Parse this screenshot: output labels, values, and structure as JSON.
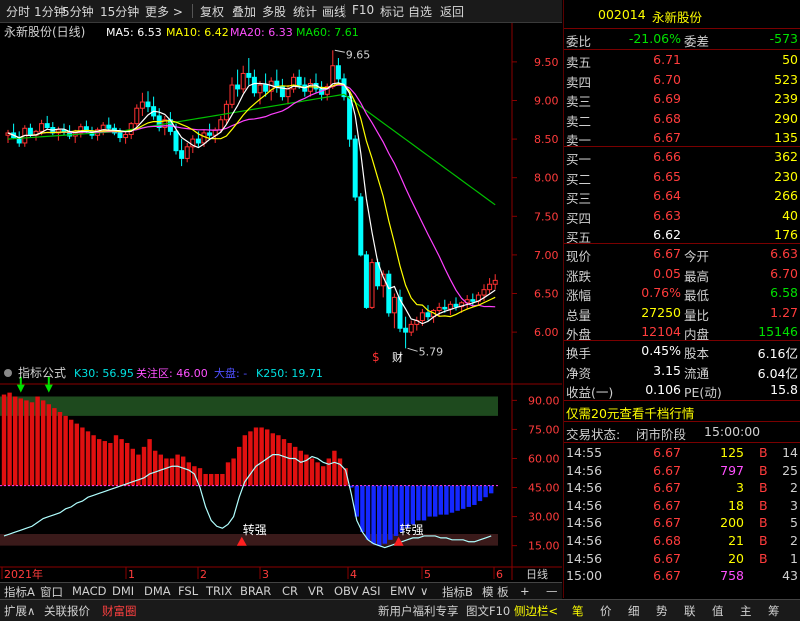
{
  "toolbar": {
    "items": [
      "分时",
      "1分钟",
      "5分钟",
      "15分钟",
      "更多 >",
      "复权",
      "叠加",
      "多股",
      "统计",
      "画线",
      "F10",
      "标记",
      "自选",
      "返回"
    ]
  },
  "stock": {
    "code": "002014",
    "name": "永新股份"
  },
  "main_legend": {
    "title": "永新股份(日线)",
    "ma5": "MA5: 6.53",
    "ma10": "MA10: 6.42",
    "ma20": "MA20: 6.33",
    "ma60": "MA60: 7.61"
  },
  "indicator_legend": {
    "title": "指标公式",
    "k30": "K30: 56.95",
    "focus": "关注区: 46.00",
    "dapan": "大盘: -",
    "k250": "K250: 19.71"
  },
  "annotations": {
    "high": "9.65",
    "low": "5.79",
    "s_mark": "$",
    "cai_mark": "财",
    "strong1": "转强",
    "strong2": "转强"
  },
  "xaxis": {
    "labels": [
      "2021年",
      "1",
      "2",
      "3",
      "4",
      "5",
      "6"
    ],
    "period": "日线"
  },
  "colors": {
    "up": "#ff3232",
    "down": "#00ffff",
    "ma5": "#ffffff",
    "ma10": "#ffff00",
    "ma20": "#ff40ff",
    "ma60": "#00c000",
    "bg": "#000000"
  },
  "chart_data": [
    {
      "type": "candlestick",
      "title": "永新股份(日线)",
      "ylim": [
        5.6,
        9.9
      ],
      "yticks": [
        6.0,
        6.5,
        7.0,
        7.5,
        8.0,
        8.5,
        9.0,
        9.5
      ],
      "ohlc": [
        [
          8.55,
          8.62,
          8.45,
          8.58
        ],
        [
          8.58,
          8.7,
          8.5,
          8.52
        ],
        [
          8.52,
          8.6,
          8.4,
          8.45
        ],
        [
          8.45,
          8.68,
          8.4,
          8.64
        ],
        [
          8.64,
          8.7,
          8.52,
          8.55
        ],
        [
          8.55,
          8.62,
          8.48,
          8.6
        ],
        [
          8.6,
          8.75,
          8.55,
          8.7
        ],
        [
          8.7,
          8.8,
          8.62,
          8.65
        ],
        [
          8.65,
          8.72,
          8.55,
          8.58
        ],
        [
          8.58,
          8.66,
          8.48,
          8.62
        ],
        [
          8.62,
          8.7,
          8.55,
          8.6
        ],
        [
          8.6,
          8.68,
          8.5,
          8.54
        ],
        [
          8.54,
          8.62,
          8.45,
          8.58
        ],
        [
          8.58,
          8.7,
          8.52,
          8.66
        ],
        [
          8.66,
          8.74,
          8.58,
          8.6
        ],
        [
          8.6,
          8.66,
          8.5,
          8.55
        ],
        [
          8.55,
          8.65,
          8.48,
          8.62
        ],
        [
          8.62,
          8.72,
          8.55,
          8.68
        ],
        [
          8.68,
          8.78,
          8.6,
          8.64
        ],
        [
          8.64,
          8.7,
          8.55,
          8.58
        ],
        [
          8.58,
          8.64,
          8.46,
          8.52
        ],
        [
          8.52,
          8.6,
          8.44,
          8.56
        ],
        [
          8.56,
          8.72,
          8.5,
          8.7
        ],
        [
          8.7,
          8.95,
          8.65,
          8.9
        ],
        [
          8.9,
          9.1,
          8.8,
          8.98
        ],
        [
          8.98,
          9.12,
          8.85,
          8.92
        ],
        [
          8.92,
          9.05,
          8.75,
          8.8
        ],
        [
          8.8,
          8.9,
          8.6,
          8.65
        ],
        [
          8.65,
          8.8,
          8.55,
          8.75
        ],
        [
          8.75,
          8.85,
          8.55,
          8.6
        ],
        [
          8.6,
          8.7,
          8.3,
          8.35
        ],
        [
          8.35,
          8.5,
          8.15,
          8.25
        ],
        [
          8.25,
          8.45,
          8.2,
          8.4
        ],
        [
          8.4,
          8.55,
          8.32,
          8.5
        ],
        [
          8.5,
          8.6,
          8.4,
          8.45
        ],
        [
          8.45,
          8.62,
          8.4,
          8.58
        ],
        [
          8.58,
          8.7,
          8.5,
          8.55
        ],
        [
          8.55,
          8.65,
          8.45,
          8.62
        ],
        [
          8.62,
          8.8,
          8.58,
          8.75
        ],
        [
          8.75,
          9.0,
          8.7,
          8.95
        ],
        [
          8.95,
          9.3,
          8.9,
          9.2
        ],
        [
          9.2,
          9.4,
          9.05,
          9.15
        ],
        [
          9.15,
          9.45,
          9.1,
          9.35
        ],
        [
          9.35,
          9.55,
          9.2,
          9.3
        ],
        [
          9.3,
          9.4,
          9.05,
          9.1
        ],
        [
          9.1,
          9.25,
          8.95,
          9.2
        ],
        [
          9.2,
          9.35,
          9.05,
          9.12
        ],
        [
          9.12,
          9.3,
          9.0,
          9.25
        ],
        [
          9.25,
          9.4,
          9.1,
          9.18
        ],
        [
          9.18,
          9.28,
          9.0,
          9.05
        ],
        [
          9.05,
          9.2,
          8.95,
          9.15
        ],
        [
          9.15,
          9.35,
          9.1,
          9.3
        ],
        [
          9.3,
          9.4,
          9.15,
          9.2
        ],
        [
          9.2,
          9.3,
          9.05,
          9.12
        ],
        [
          9.12,
          9.28,
          9.05,
          9.22
        ],
        [
          9.22,
          9.35,
          9.1,
          9.15
        ],
        [
          9.15,
          9.25,
          9.0,
          9.08
        ],
        [
          9.08,
          9.22,
          9.0,
          9.18
        ],
        [
          9.18,
          9.65,
          9.15,
          9.45
        ],
        [
          9.45,
          9.55,
          9.2,
          9.28
        ],
        [
          9.28,
          9.35,
          9.0,
          9.05
        ],
        [
          9.05,
          9.1,
          8.4,
          8.5
        ],
        [
          8.5,
          8.55,
          7.7,
          7.75
        ],
        [
          7.75,
          7.8,
          6.98,
          7.0
        ],
        [
          7.0,
          7.05,
          6.3,
          6.32
        ],
        [
          6.32,
          6.95,
          6.3,
          6.9
        ],
        [
          6.9,
          6.95,
          6.55,
          6.6
        ],
        [
          6.6,
          6.8,
          6.45,
          6.75
        ],
        [
          6.75,
          6.8,
          6.2,
          6.25
        ],
        [
          6.25,
          6.5,
          6.05,
          6.45
        ],
        [
          6.45,
          6.55,
          6.0,
          6.05
        ],
        [
          6.05,
          6.2,
          5.79,
          6.0
        ],
        [
          6.0,
          6.15,
          5.95,
          6.1
        ],
        [
          6.1,
          6.2,
          6.02,
          6.15
        ],
        [
          6.15,
          6.3,
          6.08,
          6.25
        ],
        [
          6.25,
          6.35,
          6.15,
          6.2
        ],
        [
          6.2,
          6.3,
          6.12,
          6.28
        ],
        [
          6.28,
          6.38,
          6.2,
          6.32
        ],
        [
          6.32,
          6.42,
          6.25,
          6.3
        ],
        [
          6.3,
          6.4,
          6.22,
          6.36
        ],
        [
          6.36,
          6.45,
          6.28,
          6.33
        ],
        [
          6.33,
          6.4,
          6.25,
          6.38
        ],
        [
          6.38,
          6.48,
          6.3,
          6.42
        ],
        [
          6.42,
          6.5,
          6.35,
          6.4
        ],
        [
          6.4,
          6.52,
          6.34,
          6.48
        ],
        [
          6.48,
          6.62,
          6.4,
          6.55
        ],
        [
          6.55,
          6.7,
          6.5,
          6.62
        ],
        [
          6.62,
          6.75,
          6.55,
          6.67
        ]
      ]
    },
    {
      "type": "bar",
      "title": "指标公式",
      "ylim": [
        5,
        100
      ],
      "yticks": [
        15.0,
        30.0,
        45.0,
        60.0,
        75.0,
        90.0
      ],
      "baseline": 46.0,
      "values": [
        93,
        94,
        92,
        91,
        90,
        89,
        92,
        90,
        88,
        86,
        84,
        82,
        80,
        78,
        76,
        74,
        72,
        70,
        69,
        68,
        72,
        70,
        68,
        65,
        62,
        66,
        70,
        64,
        62,
        60,
        60,
        62,
        61,
        58,
        56,
        55,
        52,
        52,
        52,
        52,
        58,
        60,
        66,
        72,
        74,
        76,
        76,
        75,
        73,
        72,
        70,
        68,
        66,
        64,
        62,
        60,
        58,
        56,
        60,
        64,
        60,
        55,
        45,
        30,
        22,
        18,
        16,
        15,
        16,
        18,
        20,
        22,
        24,
        26,
        28,
        28,
        30,
        30,
        31,
        31,
        32,
        33,
        34,
        35,
        36,
        38,
        40,
        42
      ],
      "k_line": [
        20,
        21,
        22,
        23,
        24,
        25,
        27,
        29,
        30,
        31,
        32,
        34,
        35,
        37,
        38,
        40,
        41,
        42,
        43,
        44,
        45,
        46,
        47,
        48,
        49,
        50,
        52,
        53,
        54,
        55,
        56,
        56,
        55,
        54,
        52,
        45,
        35,
        28,
        25,
        24,
        26,
        30,
        40,
        48,
        52,
        56,
        58,
        60,
        62,
        62,
        61,
        60,
        60,
        58,
        59,
        61,
        60,
        58,
        57,
        58,
        57,
        54,
        42,
        28,
        22,
        18,
        16,
        15,
        14,
        15,
        16,
        17,
        18,
        19,
        19,
        20,
        20,
        20,
        19,
        19,
        18,
        18,
        18,
        17,
        17,
        18,
        19,
        20
      ],
      "strong_zone": [
        15,
        21
      ],
      "focus_zone": [
        82,
        92
      ]
    }
  ],
  "quote": {
    "weibi_label": "委比",
    "weibi": "-21.06%",
    "weicha_label": "委差",
    "weicha": "-573",
    "asks": [
      {
        "label": "卖五",
        "price": "6.71",
        "vol": "50"
      },
      {
        "label": "卖四",
        "price": "6.70",
        "vol": "523"
      },
      {
        "label": "卖三",
        "price": "6.69",
        "vol": "239"
      },
      {
        "label": "卖二",
        "price": "6.68",
        "vol": "290"
      },
      {
        "label": "卖一",
        "price": "6.67",
        "vol": "135"
      }
    ],
    "bids": [
      {
        "label": "买一",
        "price": "6.66",
        "vol": "362"
      },
      {
        "label": "买二",
        "price": "6.65",
        "vol": "230"
      },
      {
        "label": "买三",
        "price": "6.64",
        "vol": "266"
      },
      {
        "label": "买四",
        "price": "6.63",
        "vol": "40"
      },
      {
        "label": "买五",
        "price": "6.62",
        "vol": "176"
      }
    ],
    "stats": [
      {
        "l1": "现价",
        "v1": "6.67",
        "l2": "今开",
        "v2": "6.63"
      },
      {
        "l1": "涨跌",
        "v1": "0.05",
        "l2": "最高",
        "v2": "6.70"
      },
      {
        "l1": "涨幅",
        "v1": "0.76%",
        "l2": "最低",
        "v2": "6.58"
      },
      {
        "l1": "总量",
        "v1": "27250",
        "l2": "量比",
        "v2": "1.27"
      },
      {
        "l1": "外盘",
        "v1": "12104",
        "l2": "内盘",
        "v2": "15146"
      }
    ],
    "stats2": [
      {
        "l1": "换手",
        "v1": "0.45%",
        "l2": "股本",
        "v2": "6.16亿"
      },
      {
        "l1": "净资",
        "v1": "3.15",
        "l2": "流通",
        "v2": "6.04亿"
      },
      {
        "l1": "收益(一)",
        "v1": "0.106",
        "l2": "PE(动)",
        "v2": "15.8"
      }
    ],
    "promo": "仅需20元查看千档行情",
    "status_label": "交易状态:",
    "status": "闭市阶段",
    "status_time": "15:00:00"
  },
  "ticks": [
    {
      "time": "14:55",
      "price": "6.67",
      "vol": "125",
      "side": "B",
      "count": "14"
    },
    {
      "time": "14:56",
      "price": "6.67",
      "vol": "797",
      "side": "B",
      "count": "25"
    },
    {
      "time": "14:56",
      "price": "6.67",
      "vol": "3",
      "side": "B",
      "count": "2"
    },
    {
      "time": "14:56",
      "price": "6.67",
      "vol": "18",
      "side": "B",
      "count": "3"
    },
    {
      "time": "14:56",
      "price": "6.67",
      "vol": "200",
      "side": "B",
      "count": "5"
    },
    {
      "time": "14:56",
      "price": "6.68",
      "vol": "21",
      "side": "B",
      "count": "2"
    },
    {
      "time": "14:56",
      "price": "6.67",
      "vol": "20",
      "side": "B",
      "count": "1"
    },
    {
      "time": "15:00",
      "price": "6.67",
      "vol": "758",
      "side": "",
      "count": "43"
    }
  ],
  "tabs": [
    "指标A",
    "窗口",
    "MACD",
    "DMI",
    "DMA",
    "FSL",
    "TRIX",
    "BRAR",
    "CR",
    "VR",
    "OBV",
    "ASI",
    "EMV",
    "∨",
    "指标B",
    "模 板",
    "+",
    "—"
  ],
  "bottom": {
    "left": [
      "扩展∧",
      "关联报价",
      "财富圈"
    ],
    "mid": [
      "新用户福利专享",
      "图文F10",
      "侧边栏<"
    ],
    "right": [
      "笔",
      "价",
      "细",
      "势",
      "联",
      "值",
      "主",
      "筹"
    ]
  }
}
